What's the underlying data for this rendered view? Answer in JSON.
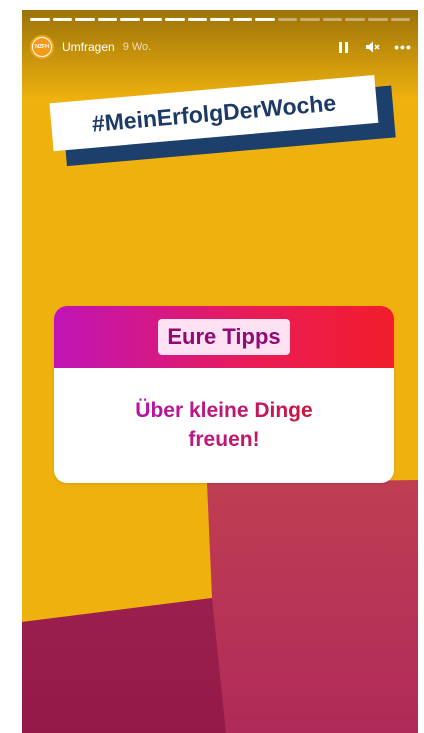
{
  "story": {
    "username": "Umfragen",
    "time": "9 Wo.",
    "avatar_text": "NZFH",
    "progress_segments_total": 17,
    "progress_segments_done": 11
  },
  "controls": {
    "pause_icon": "pause-icon",
    "mute_icon": "volume-muted-icon",
    "more_icon": "more-options-icon"
  },
  "content": {
    "hashtag": "#MeinErfolgDerWoche",
    "card_title": "Eure Tipps",
    "card_text_line1": "Über kleine Dinge",
    "card_text_line2": "freuen!"
  },
  "colors": {
    "background_yellow": "#efb10e",
    "hashtag_text": "#1d3a66",
    "hashtag_shadow": "#1d3f6b",
    "card_gradient_start": "#c014b6",
    "card_gradient_end": "#f11d2b"
  }
}
